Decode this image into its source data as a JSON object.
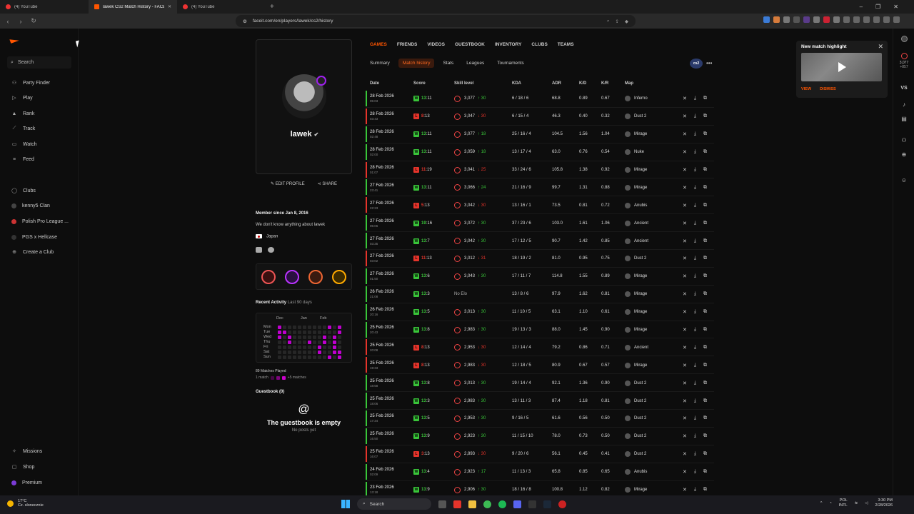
{
  "browser": {
    "tabs": [
      {
        "title": "(4) YouTube",
        "active": false
      },
      {
        "title": "lawek CS2 Match History - FACEIT",
        "active": true
      },
      {
        "title": "(4) YouTube",
        "active": false
      }
    ],
    "new_tab": "+",
    "url": "faceit.com/en/players/lawek/cs2/history",
    "window_controls": [
      "–",
      "❐",
      "✕"
    ]
  },
  "sidebar": {
    "search_label": "Search",
    "items": [
      {
        "label": "Party Finder",
        "icon": "users-icon"
      },
      {
        "label": "Play",
        "icon": "play-icon"
      },
      {
        "label": "Rank",
        "icon": "rank-icon"
      },
      {
        "label": "Track",
        "icon": "chart-icon"
      },
      {
        "label": "Watch",
        "icon": "tv-icon"
      },
      {
        "label": "Feed",
        "icon": "feed-icon"
      }
    ],
    "clubs": [
      {
        "label": "Clubs"
      },
      {
        "label": "kenny5 Clan"
      },
      {
        "label": "Polish Pro League ..."
      },
      {
        "label": "PGS x Hellcase"
      },
      {
        "label": "Create a Club"
      }
    ],
    "bottom": [
      {
        "label": "Missions"
      },
      {
        "label": "Shop"
      },
      {
        "label": "Premium"
      }
    ]
  },
  "profile": {
    "username": "lawek",
    "verified": "✔",
    "edit_label": "EDIT PROFILE",
    "share_label": "SHARE",
    "member_since": "Member since Jan 8, 2016",
    "about": "We don't know anything about lawek",
    "country": "Japan",
    "recent_activity": "Recent Activity",
    "recent_range": "Last 90 days",
    "months": [
      "Dec",
      "Jan",
      "Feb"
    ],
    "days": [
      "Mon",
      "Tue",
      "Wed",
      "Thu",
      "Fri",
      "Sat",
      "Sun"
    ],
    "matches_played": "89 Matches Played",
    "legend_min": "1 match",
    "legend_max": "+5 matches",
    "guestbook_title": "Guestbook (0)",
    "guestbook_empty": "The guestbook is empty",
    "guestbook_sub": "No posts yet"
  },
  "tabs": {
    "main": [
      "GAMES",
      "FRIENDS",
      "VIDEOS",
      "GUESTBOOK",
      "INVENTORY",
      "CLUBS",
      "TEAMS"
    ],
    "sub": [
      "Summary",
      "Match history",
      "Stats",
      "Leagues",
      "Tournaments"
    ],
    "game_logo": "cs2",
    "more": "•••"
  },
  "table": {
    "headers": [
      "Date",
      "Score",
      "Skill level",
      "KDA",
      "ADR",
      "K/D",
      "K/R",
      "Map"
    ],
    "rows": [
      {
        "date": "28 Feb 2026",
        "time": "05:03",
        "result": "W",
        "score1": "13",
        "score2": "11",
        "elo": "3,077",
        "delta": "↑ 30",
        "kda": "6 / 18 / 6",
        "adr": "68.8",
        "kd": "0.89",
        "kr": "0.67",
        "map": "Inferno"
      },
      {
        "date": "28 Feb 2026",
        "time": "03:43",
        "result": "L",
        "score1": "8",
        "score2": "13",
        "elo": "3,047",
        "delta": "↓ 30",
        "kda": "6 / 15 / 4",
        "adr": "46.3",
        "kd": "0.40",
        "kr": "0.32",
        "map": "Dust 2"
      },
      {
        "date": "28 Feb 2026",
        "time": "02:48",
        "result": "W",
        "score1": "13",
        "score2": "11",
        "elo": "3,077",
        "delta": "↑ 18",
        "kda": "25 / 16 / 4",
        "adr": "104.5",
        "kd": "1.56",
        "kr": "1.04",
        "map": "Mirage"
      },
      {
        "date": "28 Feb 2026",
        "time": "02:00",
        "result": "W",
        "score1": "13",
        "score2": "11",
        "elo": "3,059",
        "delta": "↑ 18",
        "kda": "13 / 17 / 4",
        "adr": "63.0",
        "kd": "0.76",
        "kr": "0.54",
        "map": "Nuke"
      },
      {
        "date": "28 Feb 2026",
        "time": "01:07",
        "result": "L",
        "score1": "11",
        "score2": "19",
        "elo": "3,041",
        "delta": "↓ 25",
        "kda": "33 / 24 / 6",
        "adr": "105.8",
        "kd": "1.38",
        "kr": "0.92",
        "map": "Mirage"
      },
      {
        "date": "27 Feb 2026",
        "time": "23:41",
        "result": "W",
        "score1": "13",
        "score2": "11",
        "elo": "3,066",
        "delta": "↑ 24",
        "kda": "21 / 16 / 9",
        "adr": "99.7",
        "kd": "1.31",
        "kr": "0.88",
        "map": "Mirage"
      },
      {
        "date": "27 Feb 2026",
        "time": "22:23",
        "result": "L",
        "score1": "5",
        "score2": "13",
        "elo": "3,042",
        "delta": "↓ 30",
        "kda": "13 / 16 / 1",
        "adr": "73.5",
        "kd": "0.81",
        "kr": "0.72",
        "map": "Anubis"
      },
      {
        "date": "27 Feb 2026",
        "time": "05:06",
        "result": "W",
        "score1": "19",
        "score2": "16",
        "elo": "3,072",
        "delta": "↑ 30",
        "kda": "37 / 23 / 6",
        "adr": "103.0",
        "kd": "1.61",
        "kr": "1.06",
        "map": "Ancient"
      },
      {
        "date": "27 Feb 2026",
        "time": "03:35",
        "result": "W",
        "score1": "13",
        "score2": "7",
        "elo": "3,042",
        "delta": "↑ 30",
        "kda": "17 / 12 / 5",
        "adr": "90.7",
        "kd": "1.42",
        "kr": "0.85",
        "map": "Ancient"
      },
      {
        "date": "27 Feb 2026",
        "time": "03:02",
        "result": "L",
        "score1": "11",
        "score2": "13",
        "elo": "3,012",
        "delta": "↓ 31",
        "kda": "18 / 19 / 2",
        "adr": "81.0",
        "kd": "0.95",
        "kr": "0.75",
        "map": "Dust 2"
      },
      {
        "date": "27 Feb 2026",
        "time": "01:50",
        "result": "W",
        "score1": "13",
        "score2": "6",
        "elo": "3,043",
        "delta": "↑ 30",
        "kda": "17 / 11 / 7",
        "adr": "114.8",
        "kd": "1.55",
        "kr": "0.89",
        "map": "Mirage"
      },
      {
        "date": "26 Feb 2026",
        "time": "21:08",
        "result": "W",
        "score1": "13",
        "score2": "3",
        "elo": "No Elo",
        "delta": "",
        "kda": "13 / 8 / 6",
        "adr": "97.9",
        "kd": "1.62",
        "kr": "0.81",
        "map": "Mirage"
      },
      {
        "date": "26 Feb 2026",
        "time": "20:16",
        "result": "W",
        "score1": "13",
        "score2": "5",
        "elo": "3,013",
        "delta": "↑ 30",
        "kda": "11 / 10 / 5",
        "adr": "63.1",
        "kd": "1.10",
        "kr": "0.61",
        "map": "Mirage"
      },
      {
        "date": "25 Feb 2026",
        "time": "20:43",
        "result": "W",
        "score1": "13",
        "score2": "8",
        "elo": "2,983",
        "delta": "↑ 30",
        "kda": "19 / 13 / 3",
        "adr": "88.0",
        "kd": "1.45",
        "kr": "0.90",
        "map": "Mirage"
      },
      {
        "date": "25 Feb 2026",
        "time": "20:08",
        "result": "L",
        "score1": "8",
        "score2": "13",
        "elo": "2,953",
        "delta": "↓ 30",
        "kda": "12 / 14 / 4",
        "adr": "79.2",
        "kd": "0.86",
        "kr": "0.71",
        "map": "Ancient"
      },
      {
        "date": "25 Feb 2026",
        "time": "19:33",
        "result": "L",
        "score1": "8",
        "score2": "13",
        "elo": "2,983",
        "delta": "↓ 30",
        "kda": "12 / 18 / 5",
        "adr": "80.9",
        "kd": "0.67",
        "kr": "0.57",
        "map": "Mirage"
      },
      {
        "date": "25 Feb 2026",
        "time": "18:58",
        "result": "W",
        "score1": "13",
        "score2": "8",
        "elo": "3,013",
        "delta": "↑ 30",
        "kda": "19 / 14 / 4",
        "adr": "92.1",
        "kd": "1.36",
        "kr": "0.90",
        "map": "Dust 2"
      },
      {
        "date": "25 Feb 2026",
        "time": "18:06",
        "result": "W",
        "score1": "13",
        "score2": "3",
        "elo": "2,983",
        "delta": "↑ 30",
        "kda": "13 / 11 / 3",
        "adr": "87.4",
        "kd": "1.18",
        "kr": "0.81",
        "map": "Dust 2"
      },
      {
        "date": "25 Feb 2026",
        "time": "17:34",
        "result": "W",
        "score1": "13",
        "score2": "5",
        "elo": "2,953",
        "delta": "↑ 30",
        "kda": "9 / 16 / 5",
        "adr": "61.6",
        "kd": "0.56",
        "kr": "0.50",
        "map": "Dust 2"
      },
      {
        "date": "25 Feb 2026",
        "time": "16:50",
        "result": "W",
        "score1": "13",
        "score2": "9",
        "elo": "2,923",
        "delta": "↑ 30",
        "kda": "11 / 15 / 10",
        "adr": "78.0",
        "kd": "0.73",
        "kr": "0.50",
        "map": "Dust 2"
      },
      {
        "date": "25 Feb 2026",
        "time": "16:07",
        "result": "L",
        "score1": "3",
        "score2": "13",
        "elo": "2,893",
        "delta": "↓ 30",
        "kda": "9 / 20 / 6",
        "adr": "56.1",
        "kd": "0.45",
        "kr": "0.41",
        "map": "Dust 2"
      },
      {
        "date": "24 Feb 2026",
        "time": "02:09",
        "result": "W",
        "score1": "13",
        "score2": "4",
        "elo": "2,923",
        "delta": "↑ 17",
        "kda": "11 / 13 / 3",
        "adr": "65.8",
        "kd": "0.85",
        "kr": "0.65",
        "map": "Anubis"
      },
      {
        "date": "23 Feb 2026",
        "time": "13:18",
        "result": "W",
        "score1": "13",
        "score2": "9",
        "elo": "2,906",
        "delta": "↑ 30",
        "kda": "18 / 16 / 8",
        "adr": "100.8",
        "kd": "1.12",
        "kr": "0.82",
        "map": "Mirage"
      }
    ]
  },
  "highlight": {
    "title": "New match highlight",
    "view": "VIEW",
    "dismiss": "DISMISS"
  },
  "right_rail": {
    "elo": "3,077",
    "elo_delta": "+857",
    "vs": "VS"
  },
  "taskbar": {
    "temp": "17°C",
    "weather": "Cz. slonecznie",
    "search": "Search",
    "lang1": "POL",
    "lang2": "INTL",
    "time": "3:30 PM",
    "date": "2/28/2026"
  },
  "colors": {
    "accent": "#ff5500",
    "win": "#39c539",
    "loss": "#e5342b"
  }
}
